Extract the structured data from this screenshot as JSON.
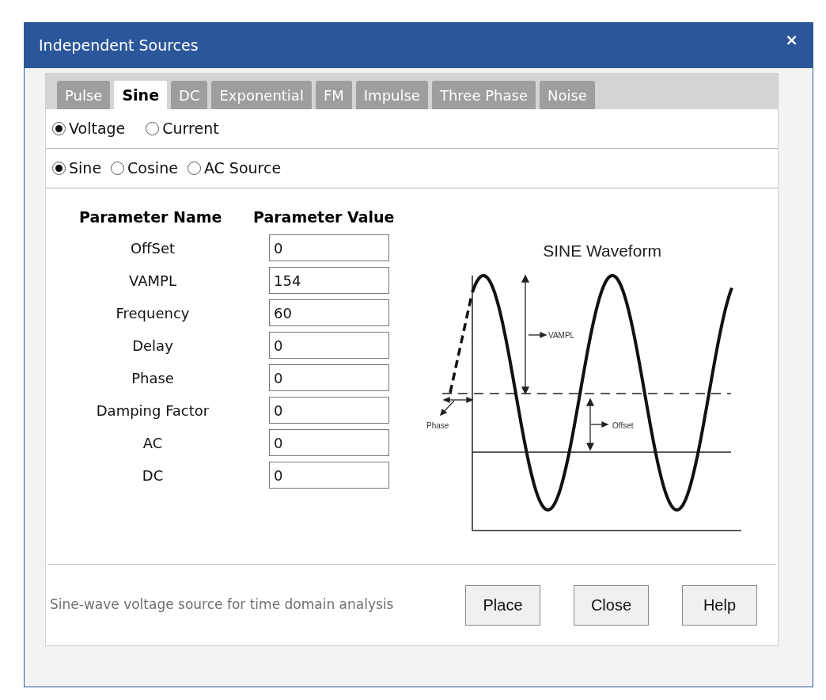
{
  "window": {
    "title": "Independent Sources",
    "close": "×"
  },
  "tabs": [
    {
      "label": "Pulse",
      "selected": false
    },
    {
      "label": "Sine",
      "selected": true
    },
    {
      "label": "DC",
      "selected": false
    },
    {
      "label": "Exponential",
      "selected": false
    },
    {
      "label": "FM",
      "selected": false
    },
    {
      "label": "Impulse",
      "selected": false
    },
    {
      "label": "Three Phase",
      "selected": false
    },
    {
      "label": "Noise",
      "selected": false
    }
  ],
  "source_type": [
    {
      "label": "Voltage",
      "selected": true
    },
    {
      "label": "Current",
      "selected": false
    }
  ],
  "waveform_type": [
    {
      "label": "Sine",
      "selected": true
    },
    {
      "label": "Cosine",
      "selected": false
    },
    {
      "label": "AC Source",
      "selected": false
    }
  ],
  "parameters": {
    "columns": [
      "Parameter Name",
      "Parameter Value"
    ],
    "rows": [
      {
        "name": "OffSet",
        "value": "0"
      },
      {
        "name": "VAMPL",
        "value": "154"
      },
      {
        "name": "Frequency",
        "value": "60"
      },
      {
        "name": "Delay",
        "value": "0"
      },
      {
        "name": "Phase",
        "value": "0"
      },
      {
        "name": "Damping Factor",
        "value": "0"
      },
      {
        "name": "AC",
        "value": "0"
      },
      {
        "name": "DC",
        "value": "0"
      }
    ]
  },
  "diagram": {
    "title": "SINE Waveform",
    "vampl_label": "VAMPL",
    "offset_label": "Offset",
    "phase_label": "Phase"
  },
  "description": "Sine-wave voltage source for time domain analysis",
  "buttons": [
    "Place",
    "Close",
    "Help"
  ]
}
